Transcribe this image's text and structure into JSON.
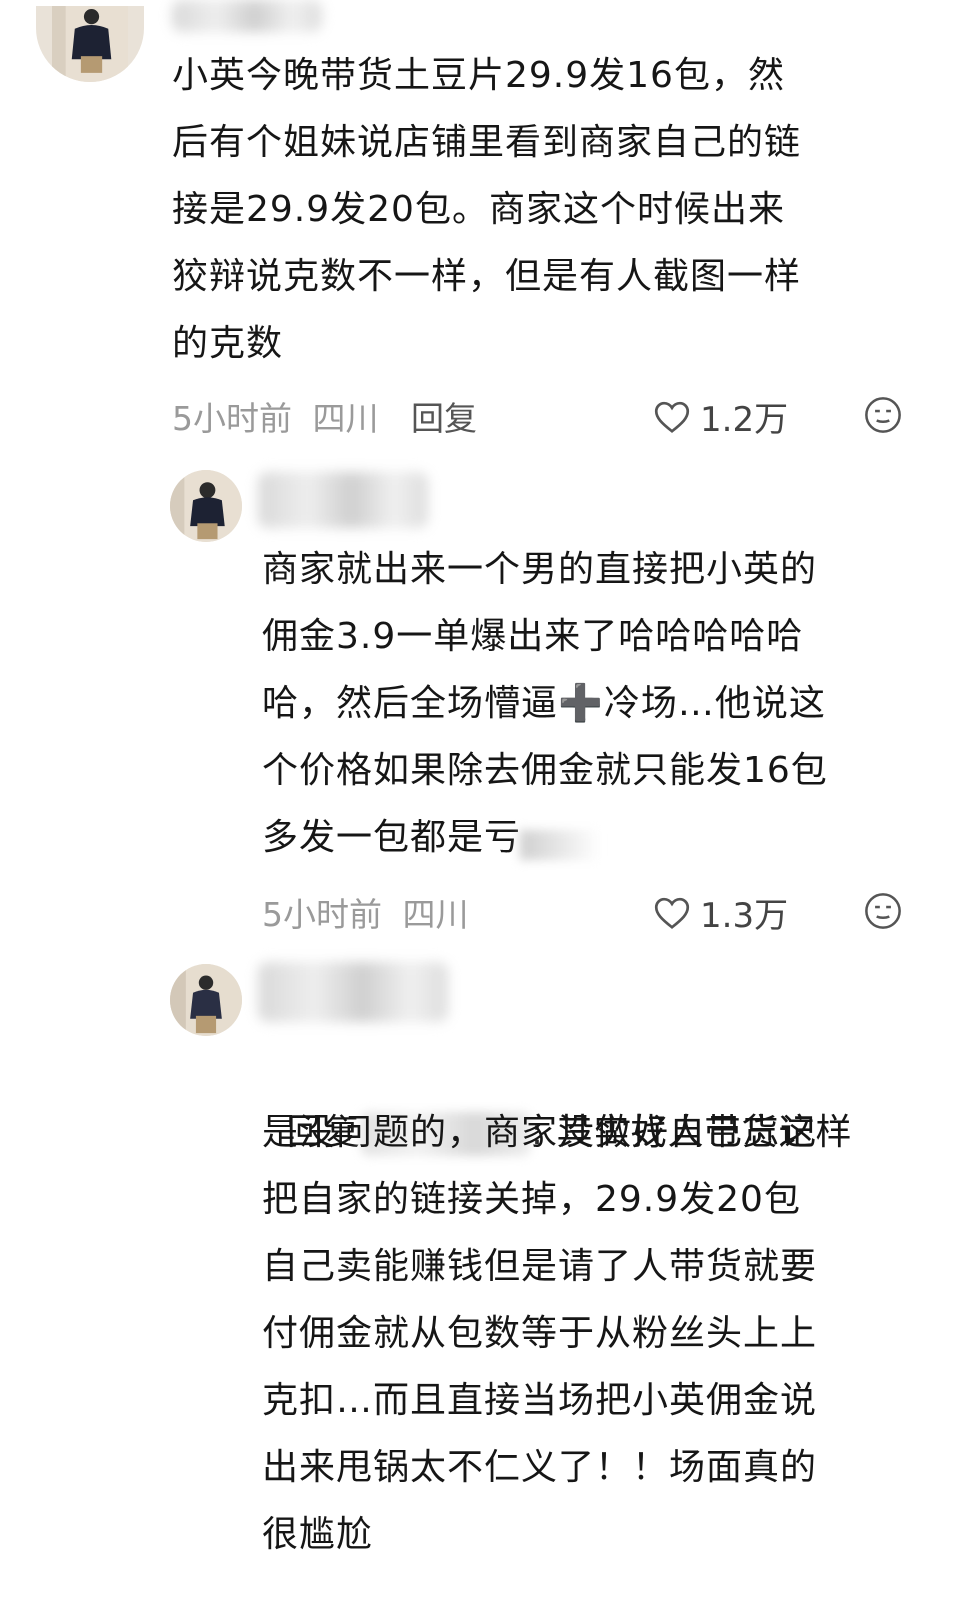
{
  "comments": [
    {
      "text": "小英今晚带货土豆片29.9发16包，然\n后有个姐妹说店铺里看到商家自己的链\n接是29.9发20包。商家这个时候出来\n狡辩说克数不一样，但是有人截图一样\n的克数",
      "time": "5小时前",
      "location": "四川",
      "reply_label": "回复",
      "likes": "1.2万"
    },
    {
      "text": "商家就出来一个男的直接把小英的\n佣金3.9一单爆出来了哈哈哈哈哈\n哈，然后全场懵逼➕冷场…他说这\n个价格如果除去佣金就只能发16包\n多发一包都是亏",
      "time": "5小时前",
      "location": "四川",
      "likes": "1.3万"
    },
    {
      "reply_prefix": "回复",
      "text_after_name": ": 其实找人带货这样",
      "text": "是没问题的，商家没做好自己忘记\n把自家的链接关掉，29.9发20包\n自己卖能赚钱但是请了人带货就要\n付佣金就从包数等于从粉丝头上上\n克扣…而且直接当场把小英佣金说\n出来甩锅太不仁义了！！场面真的\n很尴尬"
    }
  ]
}
